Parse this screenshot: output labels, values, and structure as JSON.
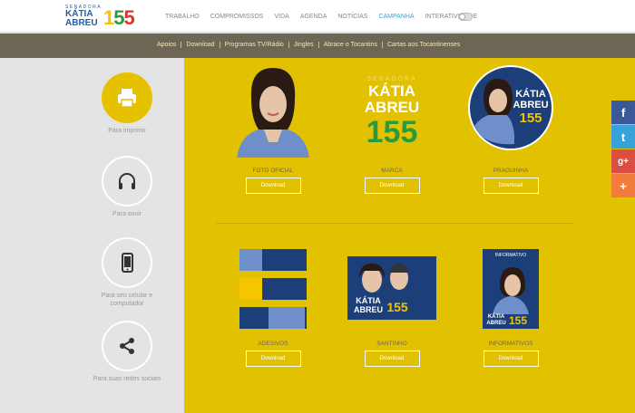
{
  "logo": {
    "prefix": "SENADORA",
    "name": "KÁTIA ABREU",
    "number": [
      "1",
      "5",
      "5"
    ]
  },
  "nav": {
    "items": [
      "TRABALHO",
      "COMPROMISSOS",
      "VIDA",
      "AGENDA",
      "NOTÍCIAS",
      "CAMPANHA",
      "INTERATIVIDADE"
    ],
    "active": "CAMPANHA"
  },
  "subnav": {
    "items": [
      "Apoios",
      "Download",
      "Programas TV/Rádio",
      "Jingles",
      "Abrace o Tocantins",
      "Cartas aos Tocantinenses"
    ]
  },
  "sidebar": {
    "items": [
      {
        "label": "Para imprimir",
        "icon": "printer-icon",
        "active": true
      },
      {
        "label": "Para ouvir",
        "icon": "headphones-icon",
        "active": false
      },
      {
        "label": "Para seu celular e computador",
        "icon": "smartphone-icon",
        "active": false
      },
      {
        "label": "Para suas redes sociais",
        "icon": "share-icon",
        "active": false
      }
    ]
  },
  "downloads": [
    {
      "label": "FOTO OFICIAL",
      "button": "Download"
    },
    {
      "label": "MARCA",
      "button": "Download",
      "mark": {
        "prefix": "SENADORA",
        "name1": "KÁTIA",
        "name2": "ABREU",
        "number": "155"
      }
    },
    {
      "label": "PRAGUINHA",
      "button": "Download",
      "badge": {
        "name1": "KÁTIA",
        "name2": "ABREU",
        "number": "155"
      }
    },
    {
      "label": "ADESIVOS",
      "button": "Download"
    },
    {
      "label": "SANTINHO",
      "button": "Download",
      "card": {
        "name1": "KÁTIA",
        "name2": "ABREU",
        "number": "155"
      }
    },
    {
      "label": "INFORMATIVOS",
      "button": "Download",
      "brochure": {
        "header": "INFORMATIVO",
        "name1": "KÁTIA",
        "name2": "ABREU",
        "number": "155"
      }
    }
  ],
  "social": {
    "facebook": "f",
    "twitter": "t",
    "googleplus": "g+",
    "more": "+"
  },
  "colors": {
    "main": "#e2c200",
    "blue": "#1c5fa8",
    "active_nav": "#35a6d7"
  }
}
